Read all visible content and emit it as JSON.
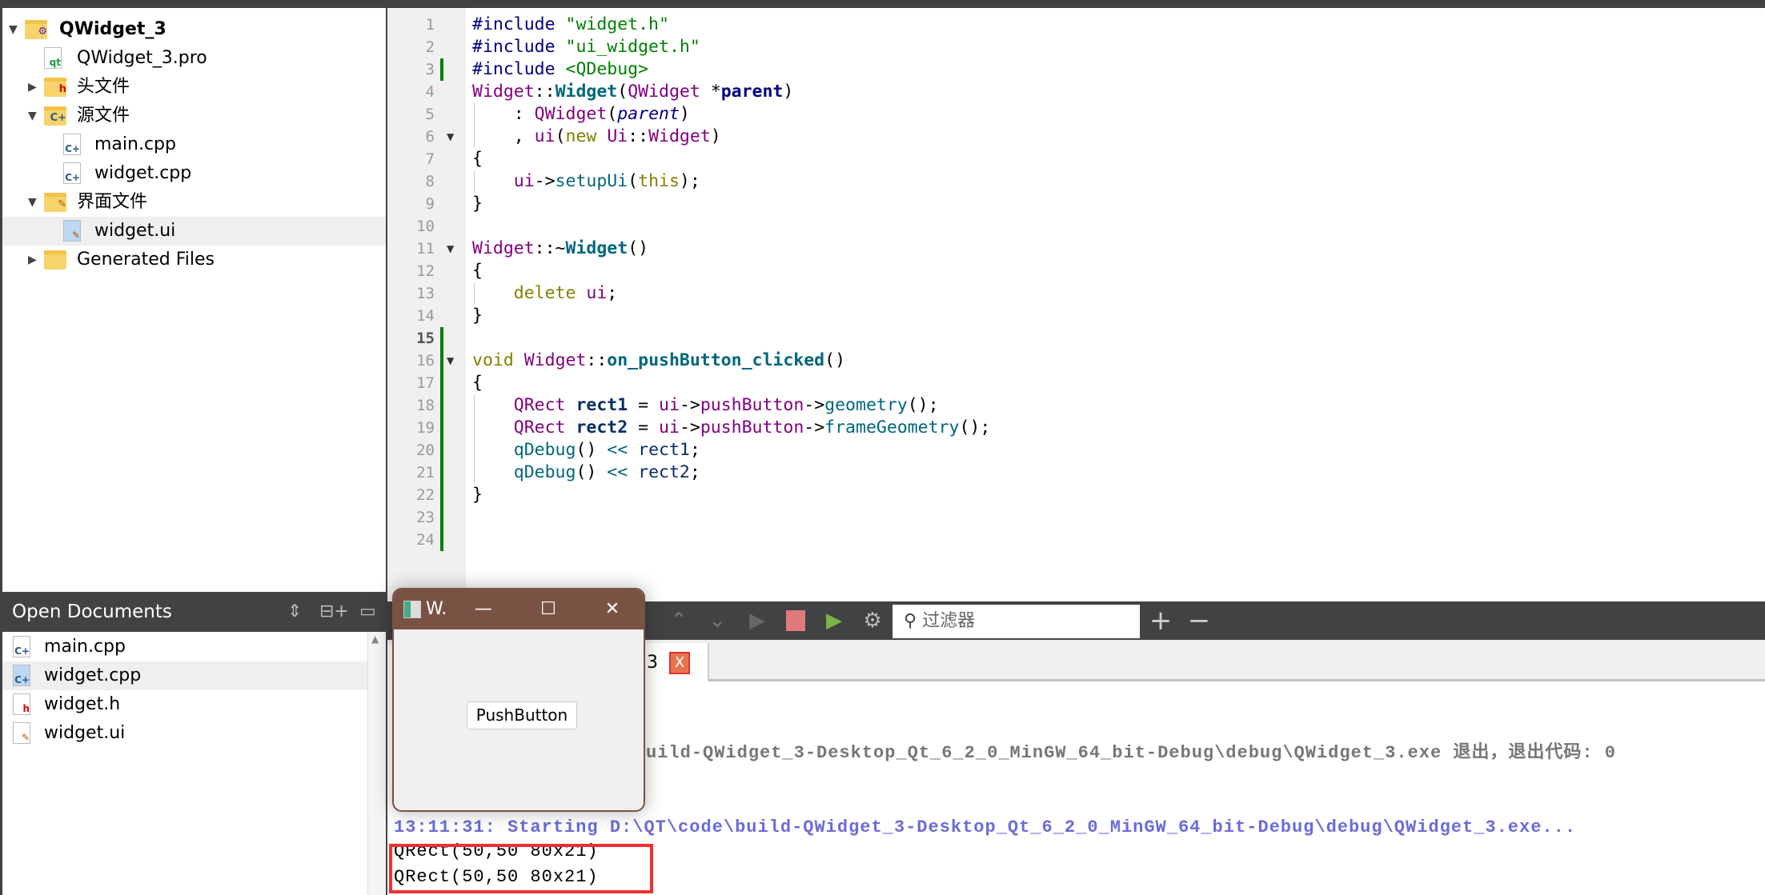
{
  "project_tree": {
    "items": [
      {
        "label": "QWidget_3",
        "level": 0,
        "expanded": true,
        "icon": "project-folder-icon",
        "bold": true
      },
      {
        "label": "QWidget_3.pro",
        "level": 1,
        "icon": "qt-pro-file-icon"
      },
      {
        "label": "头文件",
        "level": 1,
        "expanded": false,
        "icon": "header-folder-icon"
      },
      {
        "label": "源文件",
        "level": 1,
        "expanded": true,
        "icon": "source-folder-icon"
      },
      {
        "label": "main.cpp",
        "level": 2,
        "icon": "cpp-file-icon"
      },
      {
        "label": "widget.cpp",
        "level": 2,
        "icon": "cpp-file-icon"
      },
      {
        "label": "界面文件",
        "level": 1,
        "expanded": true,
        "icon": "forms-folder-icon"
      },
      {
        "label": "widget.ui",
        "level": 2,
        "icon": "ui-file-icon",
        "selected": true
      },
      {
        "label": "Generated Files",
        "level": 1,
        "expanded": false,
        "icon": "folder-icon"
      }
    ]
  },
  "editor": {
    "current_line": 15,
    "folds": [
      6,
      11,
      16
    ],
    "changed_lines": [
      3,
      15,
      16,
      17,
      18,
      19,
      20,
      21,
      22,
      23,
      24
    ],
    "lines": [
      [
        [
          "#include ",
          "pre"
        ],
        [
          "\"widget.h\"",
          "str"
        ]
      ],
      [
        [
          "#include ",
          "pre"
        ],
        [
          "\"ui_widget.h\"",
          "str"
        ]
      ],
      [
        [
          "#include ",
          "pre"
        ],
        [
          "<QDebug>",
          "str"
        ]
      ],
      [
        [
          "Widget",
          "cls"
        ],
        [
          "::",
          "op"
        ],
        [
          "Widget",
          "fn"
        ],
        [
          "(",
          "op"
        ],
        [
          "QWidget",
          "cls"
        ],
        [
          " *",
          "op"
        ],
        [
          "parent",
          "par"
        ],
        [
          ")",
          "op"
        ]
      ],
      [
        [
          "    : ",
          "op"
        ],
        [
          "QWidget",
          "cls"
        ],
        [
          "(",
          "op"
        ],
        [
          "parent",
          "it"
        ],
        [
          ")",
          "op"
        ]
      ],
      [
        [
          "    , ",
          "op"
        ],
        [
          "ui",
          "cls"
        ],
        [
          "(",
          "op"
        ],
        [
          "new",
          "kw"
        ],
        [
          " ",
          "op"
        ],
        [
          "Ui",
          "cls"
        ],
        [
          "::",
          "op"
        ],
        [
          "Widget",
          "cls"
        ],
        [
          ")",
          "op"
        ]
      ],
      [
        [
          "{",
          "op"
        ]
      ],
      [
        [
          "    ",
          "op"
        ],
        [
          "ui",
          "cls"
        ],
        [
          "->",
          "op"
        ],
        [
          "setupUi",
          "call"
        ],
        [
          "(",
          "op"
        ],
        [
          "this",
          "kw"
        ],
        [
          ");",
          "op"
        ]
      ],
      [
        [
          "}",
          "op"
        ]
      ],
      [],
      [
        [
          "Widget",
          "cls"
        ],
        [
          "::~",
          "op"
        ],
        [
          "Widget",
          "fn"
        ],
        [
          "()",
          "op"
        ]
      ],
      [
        [
          "{",
          "op"
        ]
      ],
      [
        [
          "    ",
          "op"
        ],
        [
          "delete",
          "kw"
        ],
        [
          " ",
          "op"
        ],
        [
          "ui",
          "cls"
        ],
        [
          ";",
          "op"
        ]
      ],
      [
        [
          "}",
          "op"
        ]
      ],
      [],
      [
        [
          "void",
          "kw"
        ],
        [
          " ",
          "op"
        ],
        [
          "Widget",
          "cls"
        ],
        [
          "::",
          "op"
        ],
        [
          "on_pushButton_clicked",
          "fn"
        ],
        [
          "()",
          "op"
        ]
      ],
      [
        [
          "{",
          "op"
        ]
      ],
      [
        [
          "    ",
          "op"
        ],
        [
          "QRect",
          "cls"
        ],
        [
          " ",
          "op"
        ],
        [
          "rect1",
          "loc"
        ],
        [
          " = ",
          "op"
        ],
        [
          "ui",
          "cls"
        ],
        [
          "->",
          "op"
        ],
        [
          "pushButton",
          "cls"
        ],
        [
          "->",
          "op"
        ],
        [
          "geometry",
          "call"
        ],
        [
          "();",
          "op"
        ]
      ],
      [
        [
          "    ",
          "op"
        ],
        [
          "QRect",
          "cls"
        ],
        [
          " ",
          "op"
        ],
        [
          "rect2",
          "loc"
        ],
        [
          " = ",
          "op"
        ],
        [
          "ui",
          "cls"
        ],
        [
          "->",
          "op"
        ],
        [
          "pushButton",
          "cls"
        ],
        [
          "->",
          "op"
        ],
        [
          "frameGeometry",
          "call"
        ],
        [
          "();",
          "op"
        ]
      ],
      [
        [
          "    ",
          "op"
        ],
        [
          "qDebug",
          "call"
        ],
        [
          "() ",
          "op"
        ],
        [
          "<<",
          "call"
        ],
        [
          " ",
          "op"
        ],
        [
          "rect1",
          "var"
        ],
        [
          ";",
          "op"
        ]
      ],
      [
        [
          "    ",
          "op"
        ],
        [
          "qDebug",
          "call"
        ],
        [
          "() ",
          "op"
        ],
        [
          "<<",
          "call"
        ],
        [
          " ",
          "op"
        ],
        [
          "rect2",
          "var"
        ],
        [
          ";",
          "op"
        ]
      ],
      [
        [
          "}",
          "op"
        ]
      ],
      [],
      []
    ],
    "guides": [
      5,
      6,
      8,
      13,
      18,
      19,
      20,
      21
    ]
  },
  "open_documents": {
    "title": "Open Documents",
    "items": [
      {
        "label": "main.cpp",
        "icon": "cpp-file-icon"
      },
      {
        "label": "widget.cpp",
        "icon": "cpp-file-icon",
        "selected": true
      },
      {
        "label": "widget.h",
        "icon": "header-file-icon"
      },
      {
        "label": "widget.ui",
        "icon": "ui-file-icon"
      }
    ]
  },
  "output_toolbar": {
    "filter_placeholder": "过滤器",
    "plus": "+",
    "minus": "−"
  },
  "output_tab": {
    "label_fragment": "3",
    "close": "X"
  },
  "output": {
    "exit_line": "uild-QWidget_3-Desktop_Qt_6_2_0_MinGW_64_bit-Debug\\debug\\QWidget_3.exe 退出，退出代码: 0",
    "start_line": "13:11:31: Starting D:\\QT\\code\\build-QWidget_3-Desktop_Qt_6_2_0_MinGW_64_bit-Debug\\debug\\QWidget_3.exe...",
    "debug_lines": [
      "QRect(50,50 80x21)",
      "QRect(50,50 80x21)"
    ],
    "colors": {
      "start": "#6b6bd8",
      "exit": "#767676",
      "highlight_box": "#f03030"
    }
  },
  "app_window": {
    "title": "W.",
    "minimize": "—",
    "maximize": "☐",
    "close": "✕",
    "button_label": "PushButton",
    "titlebar_color": "#7a5244"
  }
}
